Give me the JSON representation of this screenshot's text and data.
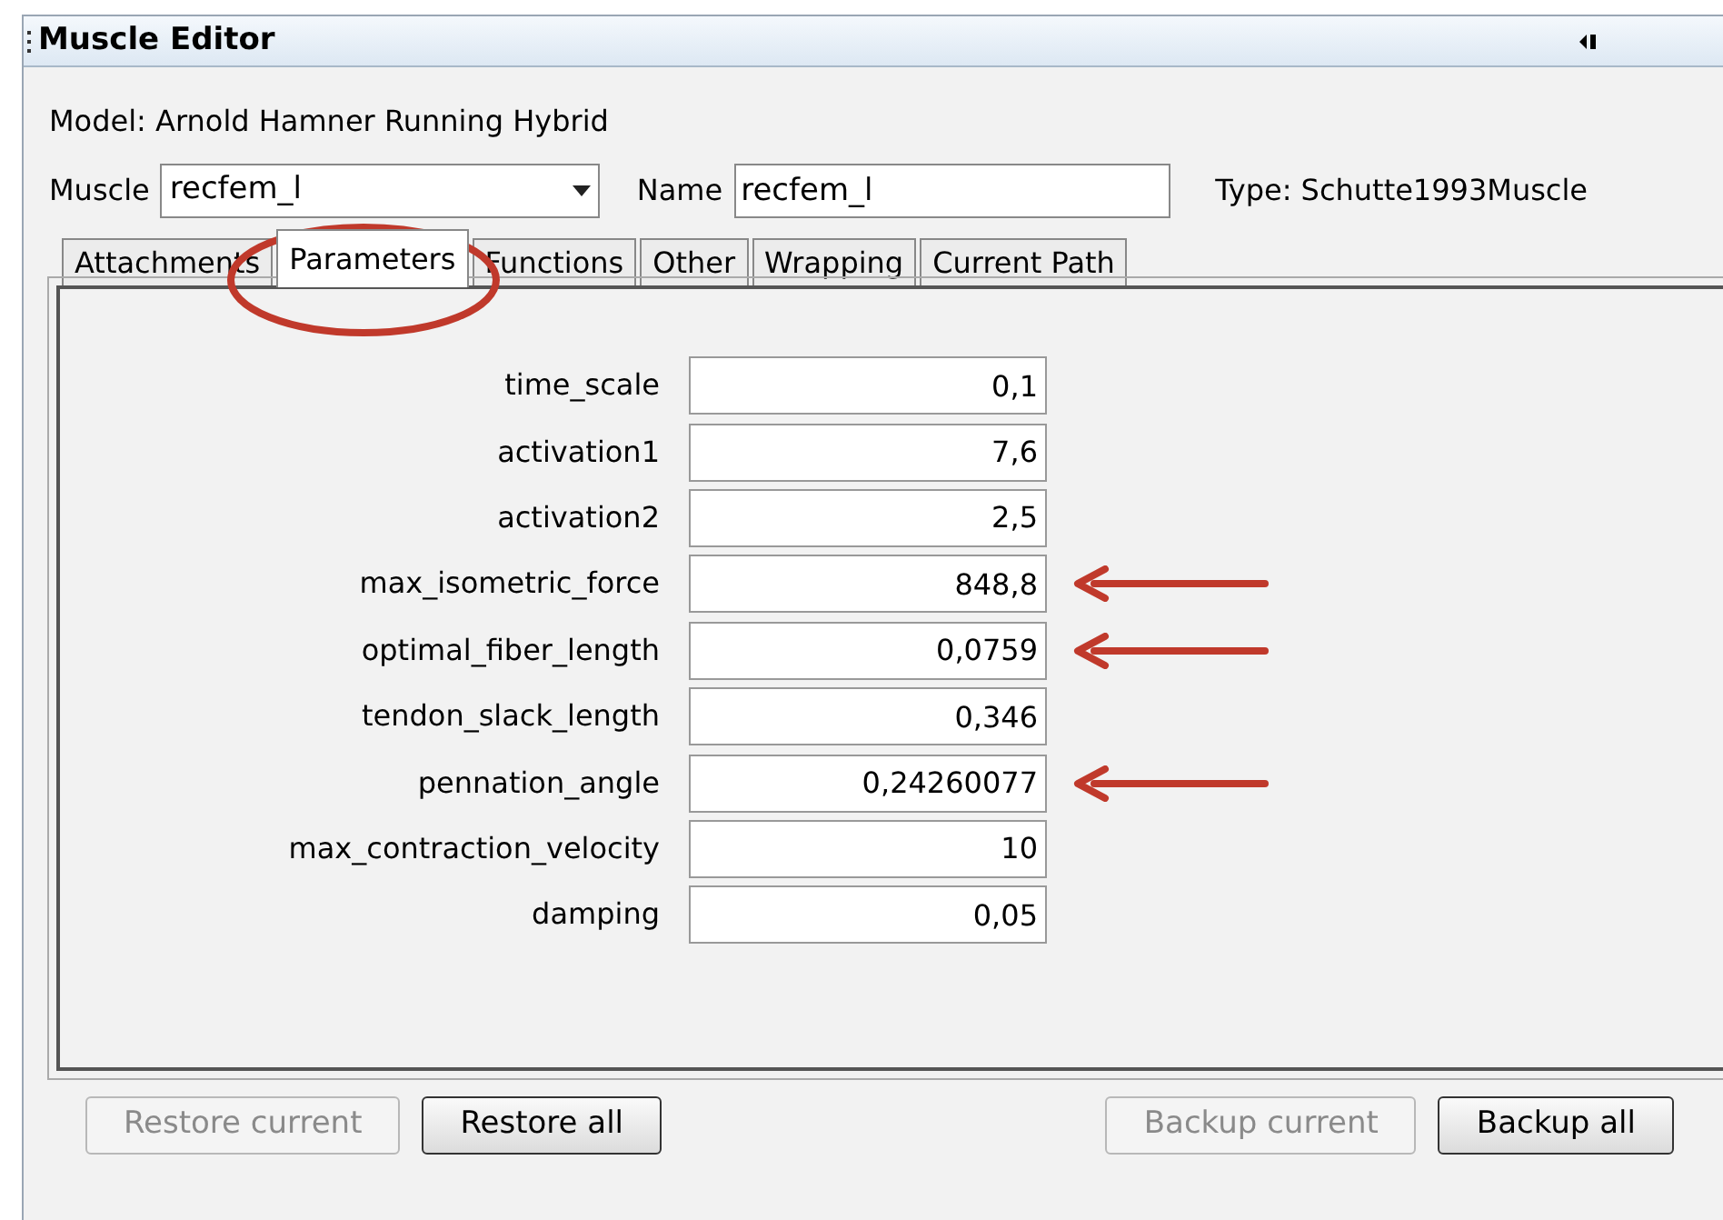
{
  "window": {
    "title": "Muscle Editor"
  },
  "model_label": "Model: Arnold Hamner Running Hybrid",
  "muscle": {
    "label": "Muscle",
    "value": "recfem_l"
  },
  "name": {
    "label": "Name",
    "value": "recfem_l"
  },
  "type_label": "Type: Schutte1993Muscle",
  "tabs": [
    {
      "label": "Attachments",
      "selected": false
    },
    {
      "label": "Parameters",
      "selected": true
    },
    {
      "label": "Functions",
      "selected": false
    },
    {
      "label": "Other",
      "selected": false
    },
    {
      "label": "Wrapping",
      "selected": false
    },
    {
      "label": "Current Path",
      "selected": false
    }
  ],
  "parameters": [
    {
      "name": "time_scale",
      "value": "0,1",
      "highlighted": false
    },
    {
      "name": "activation1",
      "value": "7,6",
      "highlighted": false
    },
    {
      "name": "activation2",
      "value": "2,5",
      "highlighted": false
    },
    {
      "name": "max_isometric_force",
      "value": "848,8",
      "highlighted": true
    },
    {
      "name": "optimal_fiber_length",
      "value": "0,0759",
      "highlighted": true
    },
    {
      "name": "tendon_slack_length",
      "value": "0,346",
      "highlighted": false
    },
    {
      "name": "pennation_angle",
      "value": "0,24260077",
      "highlighted": true
    },
    {
      "name": "max_contraction_velocity",
      "value": "10",
      "highlighted": false
    },
    {
      "name": "damping",
      "value": "0,05",
      "highlighted": false
    }
  ],
  "buttons": [
    {
      "label": "Restore current",
      "disabled": true
    },
    {
      "label": "Restore all",
      "disabled": false
    },
    {
      "label": "Backup current",
      "disabled": true
    },
    {
      "label": "Backup all",
      "disabled": false
    }
  ]
}
